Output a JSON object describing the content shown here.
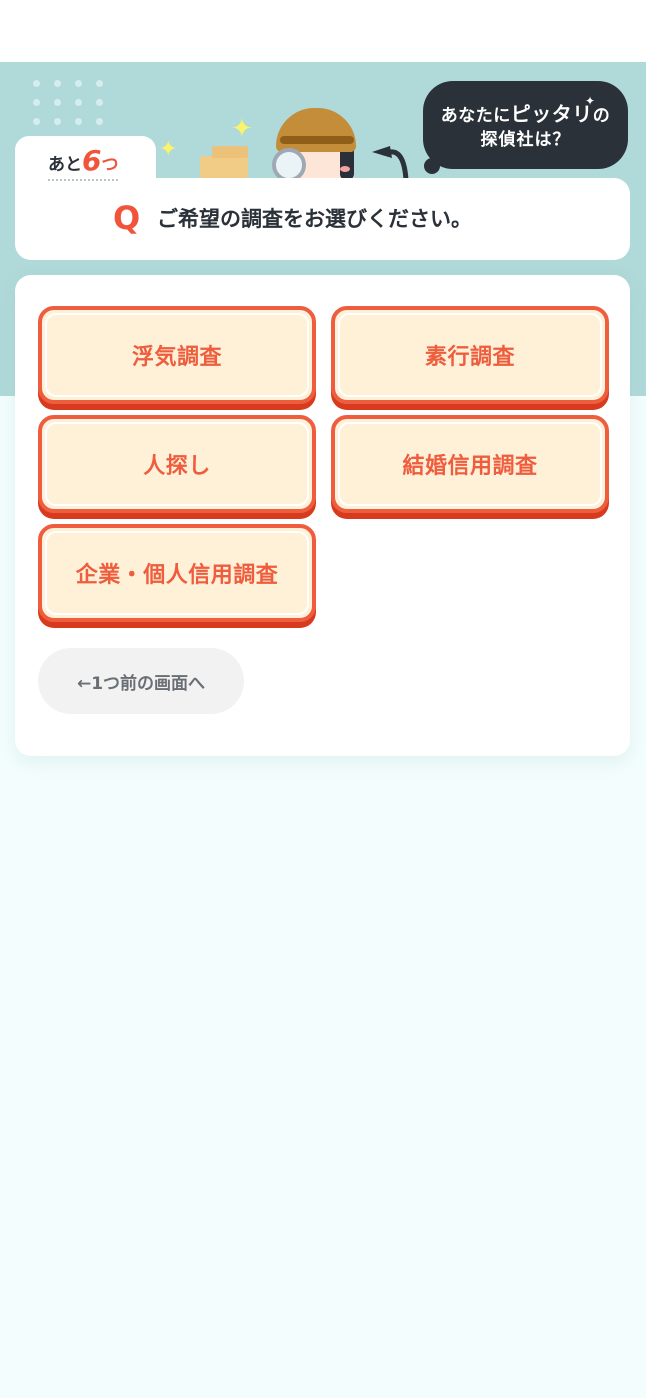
{
  "header": {
    "speech_bubble": {
      "line1_prefix": "あなたに",
      "line1_accent": "ピッタリ",
      "line1_suffix": "の",
      "line2": "探偵社は？"
    },
    "remaining": {
      "prefix": "あと",
      "count": "6",
      "suffix": "つ"
    }
  },
  "question": {
    "marker": "Q",
    "text": "ご希望の調査をお選びください。"
  },
  "options": [
    {
      "label": "浮気調査"
    },
    {
      "label": "素行調査"
    },
    {
      "label": "人探し"
    },
    {
      "label": "結婚信用調査"
    },
    {
      "label": "企業・個人信用調査"
    }
  ],
  "back_button": {
    "label": "←1つ前の画面へ"
  },
  "colors": {
    "accent": "#ef5d3f",
    "teal_band": "#b0d9d9",
    "option_fill": "#fff1d7",
    "text_dark": "#2b3139",
    "page_bg": "#f3fdfd"
  }
}
